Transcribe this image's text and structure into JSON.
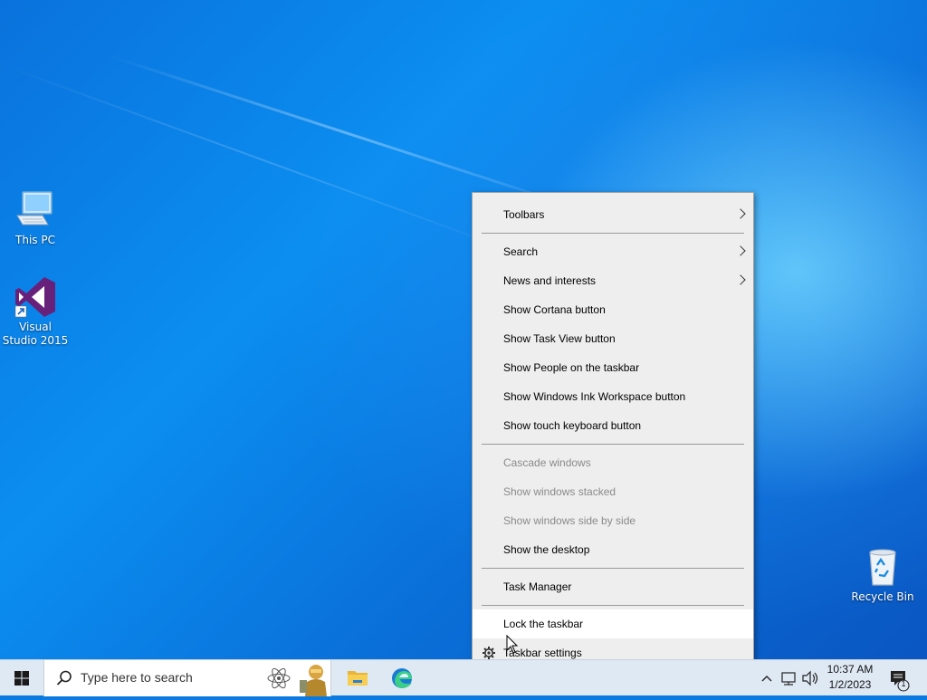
{
  "desktop": {
    "icons": [
      {
        "name": "this-pc",
        "label": "This PC"
      },
      {
        "name": "visual-studio-2015",
        "label": "Visual Studio 2015"
      },
      {
        "name": "recycle-bin",
        "label": "Recycle Bin"
      }
    ]
  },
  "context_menu": {
    "items": [
      {
        "label": "Toolbars",
        "submenu": true,
        "enabled": true
      },
      {
        "label": "Search",
        "submenu": true,
        "enabled": true
      },
      {
        "label": "News and interests",
        "submenu": true,
        "enabled": true
      },
      {
        "label": "Show Cortana button",
        "enabled": true
      },
      {
        "label": "Show Task View button",
        "enabled": true
      },
      {
        "label": "Show People on the taskbar",
        "enabled": true
      },
      {
        "label": "Show Windows Ink Workspace button",
        "enabled": true
      },
      {
        "label": "Show touch keyboard button",
        "enabled": true
      },
      {
        "label": "Cascade windows",
        "enabled": false
      },
      {
        "label": "Show windows stacked",
        "enabled": false
      },
      {
        "label": "Show windows side by side",
        "enabled": false
      },
      {
        "label": "Show the desktop",
        "enabled": true
      },
      {
        "label": "Task Manager",
        "enabled": true
      },
      {
        "label": "Lock the taskbar",
        "enabled": true,
        "highlighted": true
      },
      {
        "label": "Taskbar settings",
        "enabled": true,
        "icon": "gear-icon"
      }
    ]
  },
  "taskbar": {
    "search_placeholder": "Type here to search",
    "pinned": [
      "file-explorer-icon",
      "edge-icon"
    ],
    "clock": {
      "time": "10:37 AM",
      "date": "1/2/2023"
    },
    "notification_count": "1"
  },
  "colors": {
    "accent": "#0078d7",
    "menu_bg": "#eeeeee",
    "disabled_text": "#8a8a8a",
    "taskbar_bg": "#dfe9f4"
  }
}
